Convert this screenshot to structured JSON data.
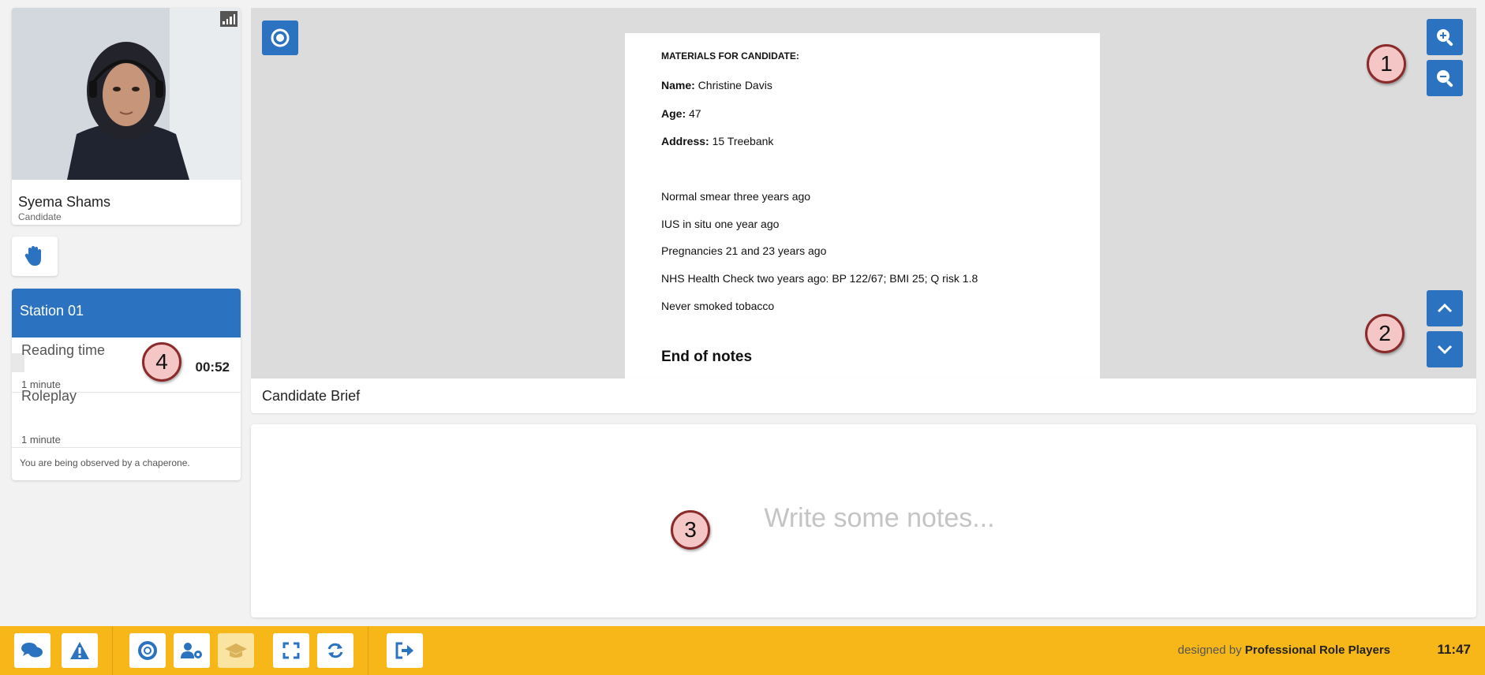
{
  "participant": {
    "name": "Syema Shams",
    "role": "Candidate"
  },
  "station": {
    "title": "Station 01",
    "stages": [
      {
        "name": "Reading time",
        "duration": "1 minute",
        "remaining": "00:52"
      },
      {
        "name": "Roleplay",
        "duration": "1 minute"
      }
    ],
    "chaperone_notice": "You are being observed by a chaperone."
  },
  "document": {
    "heading": "MATERIALS FOR CANDIDATE:",
    "fields": [
      {
        "label": "Name:",
        "value": " Christine Davis"
      },
      {
        "label": "Age:",
        "value": " 47"
      },
      {
        "label": "Address:",
        "value": " 15 Treebank"
      }
    ],
    "notes": [
      "Normal smear three years ago",
      "IUS in situ one year ago",
      "Pregnancies 21 and 23 years ago",
      "NHS Health Check two years ago: BP 122/67; BMI 25; Q risk 1.8",
      "Never smoked tobacco"
    ],
    "end_text": "End of notes",
    "caption": "Candidate Brief"
  },
  "notes_input": {
    "placeholder": "Write some notes..."
  },
  "callouts": [
    "1",
    "2",
    "3",
    "4"
  ],
  "toolbar": {
    "credit_prefix": "designed by",
    "credit_brand": "Professional Role Players",
    "clock": "11:47"
  },
  "icons": {
    "chat": "chat-icon",
    "warning": "warning-icon",
    "help": "lifebuoy-icon",
    "user_settings": "user-gear-icon",
    "graduation": "graduation-cap-icon",
    "fullscreen": "fullscreen-icon",
    "refresh": "refresh-icon",
    "exit": "exit-icon"
  },
  "colors": {
    "primary": "#2b73c0",
    "toolbar": "#f7b719",
    "callout_fill": "#f4c6c6",
    "callout_border": "#8a2a2a"
  }
}
